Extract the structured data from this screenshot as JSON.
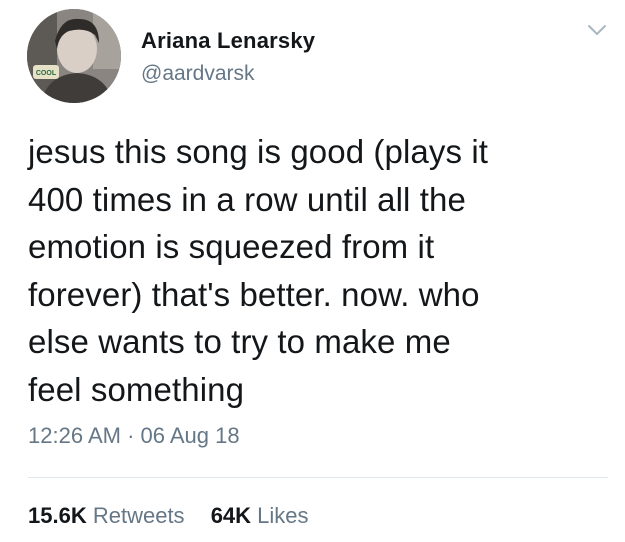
{
  "user": {
    "display_name": "Ariana Lenarsky",
    "handle": "@aardvarsk",
    "avatar_badge": "COOL"
  },
  "tweet": {
    "text": "jesus this song is good (plays it\n400 times in a row until all the\nemotion is squeezed from it\nforever) that's better. now. who\nelse wants to try to make me\nfeel something",
    "timestamp": "12:26 AM · 06 Aug 18"
  },
  "stats": {
    "retweets_count": "15.6K",
    "retweets_label": "Retweets",
    "likes_count": "64K",
    "likes_label": "Likes"
  },
  "icons": {
    "menu": "chevron-down-icon"
  },
  "colors": {
    "secondary_text": "#657786",
    "primary_text": "#14171a",
    "divider": "#e1e8ed"
  }
}
